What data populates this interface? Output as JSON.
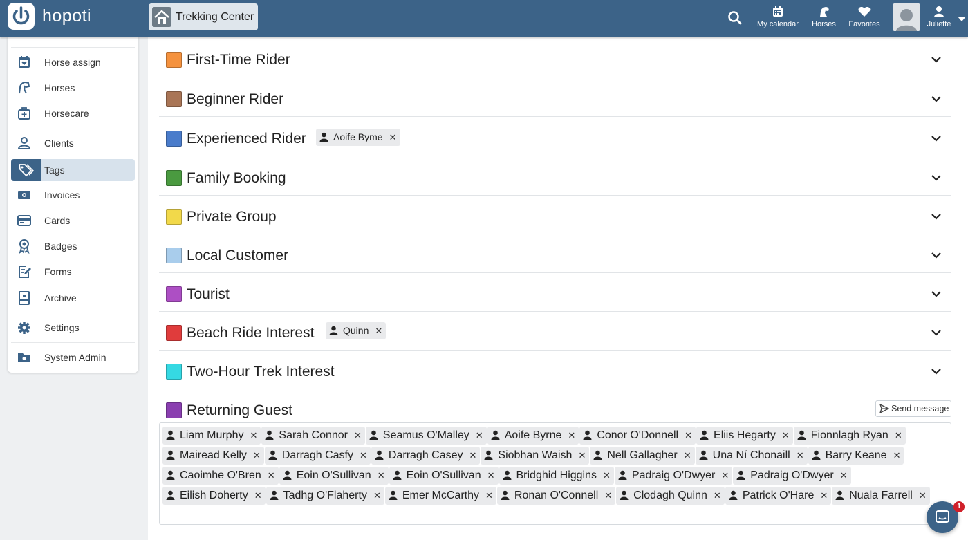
{
  "app": {
    "name": "hopoti"
  },
  "venue": {
    "name": "Trekking Center"
  },
  "nav": {
    "calendar": "My calendar",
    "horses": "Horses",
    "favorites": "Favorites",
    "user": "Juliette"
  },
  "sidebar": {
    "items": [
      {
        "label": "Horse assign",
        "icon": "calendar-heart-icon"
      },
      {
        "label": "Horses",
        "icon": "horse-icon"
      },
      {
        "label": "Horsecare",
        "icon": "medical-kit-icon"
      },
      {
        "label": "Clients",
        "icon": "person-icon"
      },
      {
        "label": "Tags",
        "icon": "tags-icon"
      },
      {
        "label": "Invoices",
        "icon": "money-icon"
      },
      {
        "label": "Cards",
        "icon": "card-icon"
      },
      {
        "label": "Badges",
        "icon": "badge-icon"
      },
      {
        "label": "Forms",
        "icon": "form-icon"
      },
      {
        "label": "Archive",
        "icon": "archive-icon"
      },
      {
        "label": "Settings",
        "icon": "gear-icon"
      },
      {
        "label": "System Admin",
        "icon": "admin-folder-icon"
      }
    ],
    "active": "Tags"
  },
  "tags": [
    {
      "name": "First-Time Rider",
      "color": "#f5923e"
    },
    {
      "name": "Beginner Rider",
      "color": "#a97556"
    },
    {
      "name": "Experienced Rider",
      "color": "#4a7ccb",
      "chip": "Aoife Byme"
    },
    {
      "name": "Family Booking",
      "color": "#4a9a40"
    },
    {
      "name": "Private Group",
      "color": "#f2d94a"
    },
    {
      "name": "Local Customer",
      "color": "#a9cdec"
    },
    {
      "name": "Tourist",
      "color": "#ad4fc4"
    },
    {
      "name": "Beach Ride Interest",
      "color": "#e03c3c",
      "chip": "Quinn"
    },
    {
      "name": "Two-Hour Trek Interest",
      "color": "#35d9e3"
    },
    {
      "name": "Returning Guest",
      "color": "#8a3fb0"
    }
  ],
  "expanded": {
    "send_message": "Send message",
    "members": [
      "Liam Murphy",
      "Sarah Connor",
      "Seamus O'Malley",
      "Aoife Byrne",
      "Conor O'Donnell",
      "Eliis Hegarty",
      "Fionnlagh Ryan",
      "Mairead Kelly",
      "Darragh Casfy",
      "Darragh Casey",
      "Siobhan Waish",
      "Nell Gallagher",
      "Una Ní Chonaill",
      "Barry Keane",
      "Caoimhe O'Bren",
      "Eoin O'Sullivan",
      "Eoin O'Sullivan",
      "Bridghid Higgins",
      "Padraig O'Dwyer",
      "Padraig O'Dwyer",
      "Eilish Doherty",
      "Tadhg O'Flaherty",
      "Emer McCarthy",
      "Ronan O'Connell",
      "Clodagh Quinn",
      "Patrick O'Hare",
      "Nuala Farrell"
    ]
  },
  "chat": {
    "badge": "1"
  }
}
